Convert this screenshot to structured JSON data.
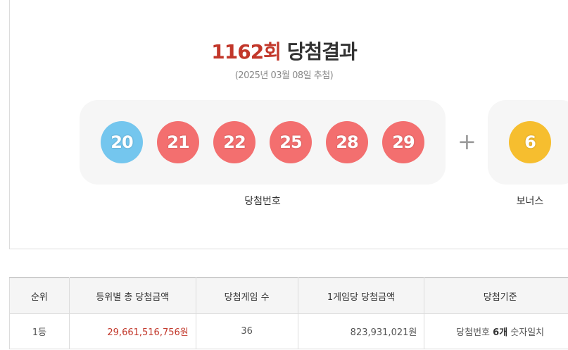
{
  "header": {
    "round": "1162회",
    "title_suffix": "당첨결과",
    "draw_date": "(2025년 03월 08일 추첨)"
  },
  "numbers": {
    "winning": [
      {
        "value": "20",
        "color": "#74c6ee"
      },
      {
        "value": "21",
        "color": "#f36f6f"
      },
      {
        "value": "22",
        "color": "#f36f6f"
      },
      {
        "value": "25",
        "color": "#f36f6f"
      },
      {
        "value": "28",
        "color": "#f36f6f"
      },
      {
        "value": "29",
        "color": "#f36f6f"
      }
    ],
    "plus_symbol": "+",
    "bonus": {
      "value": "6",
      "color": "#f6be2f"
    },
    "winning_label": "당첨번호",
    "bonus_label": "보너스"
  },
  "table": {
    "headers": [
      "순위",
      "등위별 총 당첨금액",
      "당첨게임 수",
      "1게임당 당첨금액",
      "당첨기준"
    ],
    "rows": [
      {
        "rank": "1등",
        "total_prize": "29,661,516,756원",
        "winners": "36",
        "prize_per_game": "823,931,021원",
        "criteria_prefix": "당첨번호 ",
        "criteria_count": "6개",
        "criteria_suffix": " 숫자일치"
      }
    ]
  },
  "colors": {
    "accent_red": "#c2372a",
    "ball_blue": "#74c6ee",
    "ball_red": "#f36f6f",
    "ball_yellow": "#f6be2f"
  }
}
